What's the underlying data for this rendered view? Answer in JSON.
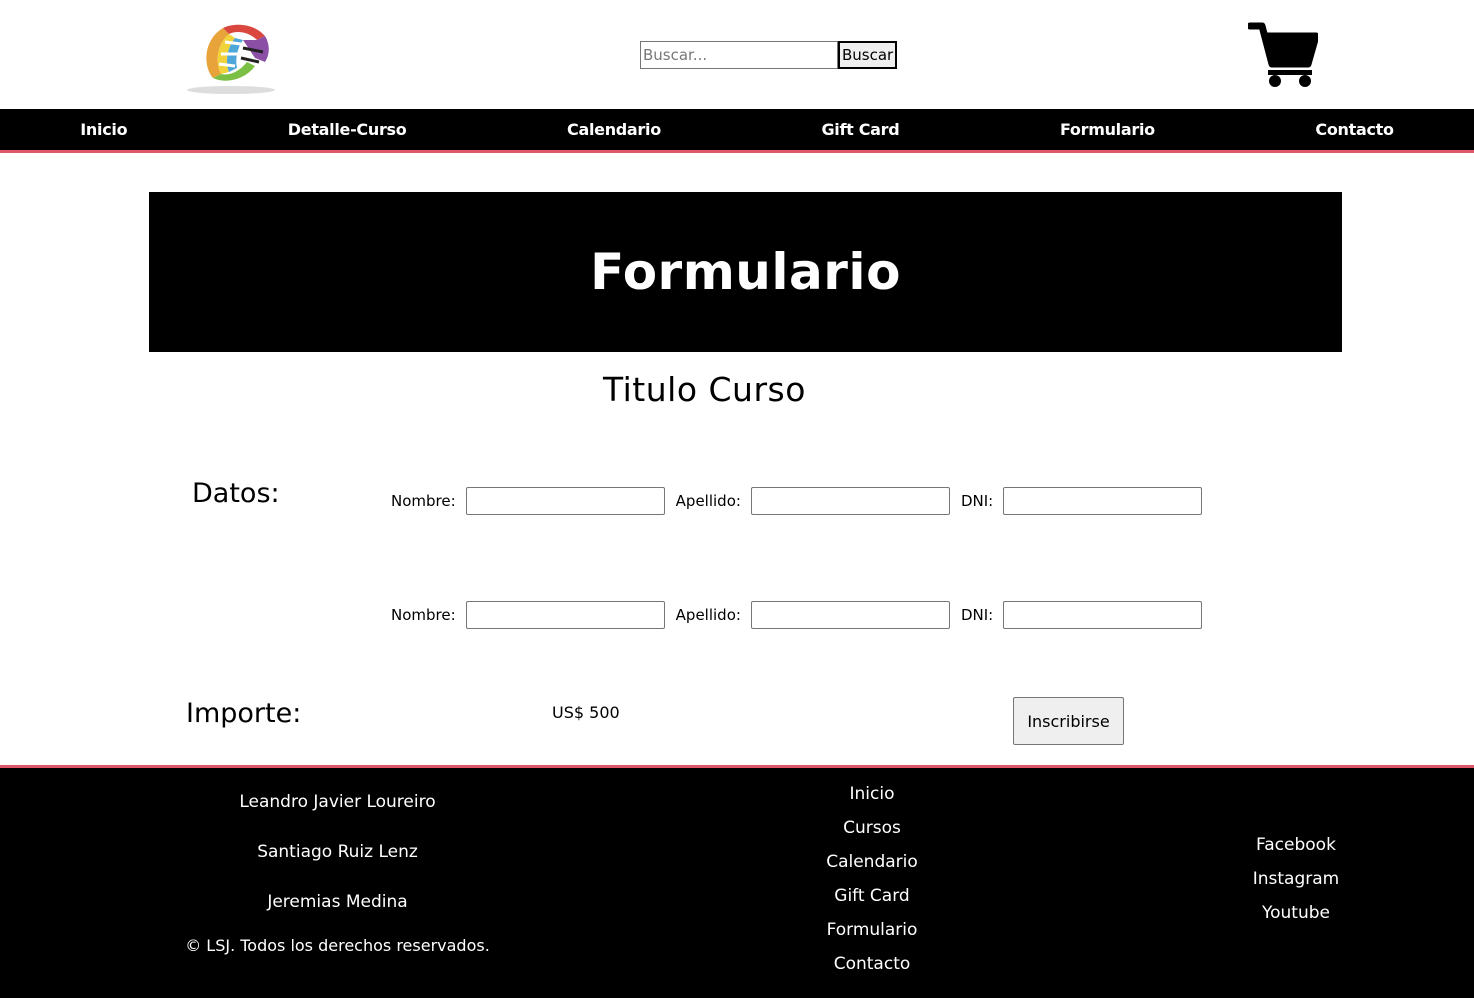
{
  "header": {
    "search_placeholder": "Buscar...",
    "search_button": "Buscar"
  },
  "nav": {
    "items": [
      "Inicio",
      "Detalle-Curso",
      "Calendario",
      "Gift Card",
      "Formulario",
      "Contacto"
    ]
  },
  "banner": {
    "title": "Formulario"
  },
  "course": {
    "title": "Titulo Curso"
  },
  "form": {
    "section_label": "Datos:",
    "rows": [
      {
        "nombre": "Nombre:",
        "apellido": "Apellido:",
        "dni": "DNI:"
      },
      {
        "nombre": "Nombre:",
        "apellido": "Apellido:",
        "dni": "DNI:"
      }
    ],
    "importe_label": "Importe:",
    "amount": "US$ 500",
    "submit_label": "Inscribirse"
  },
  "footer": {
    "authors": [
      "Leandro Javier Loureiro",
      "Santiago Ruiz Lenz",
      "Jeremias Medina"
    ],
    "copyright": "© LSJ. Todos los derechos reservados.",
    "nav": [
      "Inicio",
      "Cursos",
      "Calendario",
      "Gift Card",
      "Formulario",
      "Contacto"
    ],
    "social": [
      "Facebook",
      "Instagram",
      "Youtube"
    ]
  },
  "colors": {
    "accent": "#e0566b",
    "nav_bg": "#000000"
  },
  "icons": {
    "logo": "globe-logo-icon",
    "cart": "shopping-cart-icon"
  }
}
